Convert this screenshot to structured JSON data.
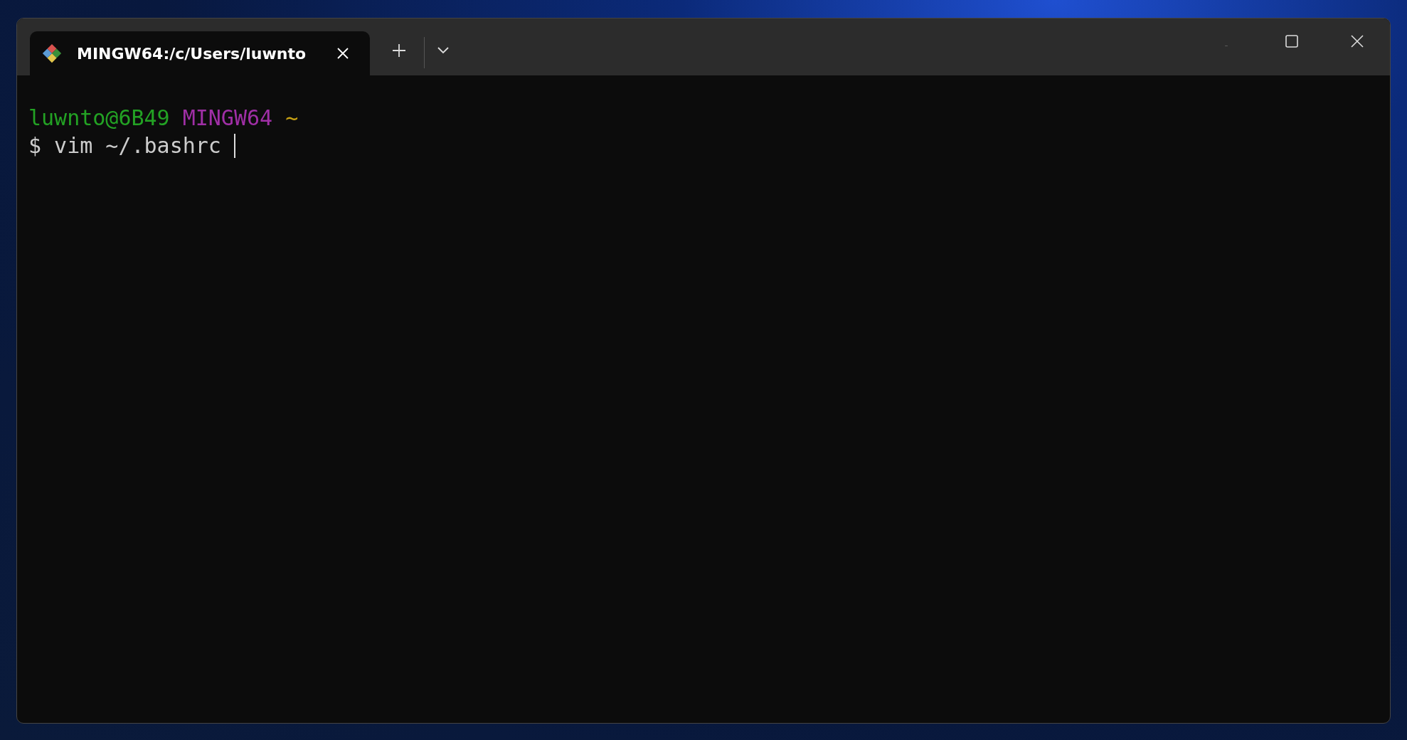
{
  "tabs": [
    {
      "title": "MINGW64:/c/Users/luwnto",
      "selected": true
    }
  ],
  "terminal": {
    "lines": [
      {
        "segments": [
          {
            "text": "luwnto@6B49",
            "color": "#23a224"
          },
          {
            "text": "MINGW64",
            "color": "#a02fa6"
          },
          {
            "text": "~",
            "color": "#c8a214"
          }
        ]
      },
      {
        "segments": [
          {
            "text": "$ vim ~/.bashrc",
            "color": "#cccccc"
          }
        ],
        "cursor": true
      }
    ]
  }
}
